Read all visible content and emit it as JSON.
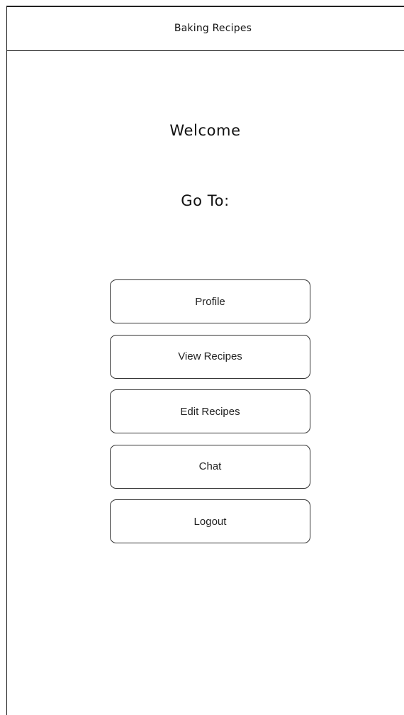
{
  "header": {
    "title": "Baking Recipes"
  },
  "main": {
    "welcome": "Welcome",
    "goto_label": "Go To:",
    "menu": [
      {
        "label": "Profile"
      },
      {
        "label": "View Recipes"
      },
      {
        "label": "Edit Recipes"
      },
      {
        "label": "Chat"
      },
      {
        "label": "Logout"
      }
    ]
  },
  "colors": {
    "background": "#ffffff",
    "border": "#333333",
    "text": "#222222"
  }
}
